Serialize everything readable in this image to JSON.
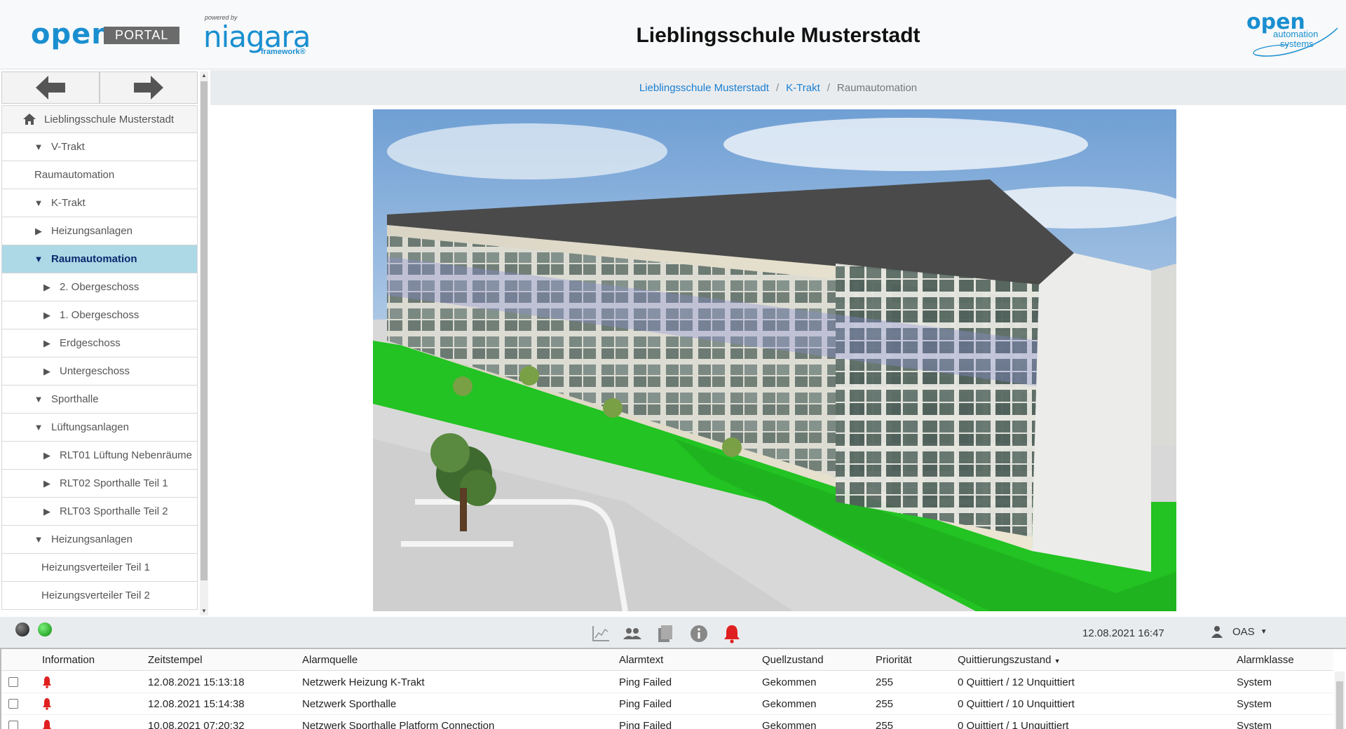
{
  "header": {
    "logo_open": "open",
    "logo_portal": "PORTAL",
    "niagara_powered": "powered by",
    "niagara_name": "niagara",
    "niagara_framework": "framework®",
    "title": "Lieblingsschule Musterstadt",
    "oas_open": "open",
    "oas_line1": "automation",
    "oas_line2": "systems"
  },
  "sidebar": {
    "items": [
      {
        "label": "Lieblingsschule Musterstadt",
        "icon": "home-icon"
      },
      {
        "label": "V-Trakt",
        "icon": "triangle-down-icon"
      },
      {
        "label": "Raumautomation",
        "icon": ""
      },
      {
        "label": "K-Trakt",
        "icon": "triangle-down-icon"
      },
      {
        "label": "Heizungsanlagen",
        "icon": "triangle-right-icon"
      },
      {
        "label": "Raumautomation",
        "icon": "triangle-down-icon"
      },
      {
        "label": "2. Obergeschoss",
        "icon": "triangle-right-icon"
      },
      {
        "label": "1. Obergeschoss",
        "icon": "triangle-right-icon"
      },
      {
        "label": "Erdgeschoss",
        "icon": "triangle-right-icon"
      },
      {
        "label": "Untergeschoss",
        "icon": "triangle-right-icon"
      },
      {
        "label": "Sporthalle",
        "icon": "triangle-down-icon"
      },
      {
        "label": "Lüftungsanlagen",
        "icon": "triangle-down-icon"
      },
      {
        "label": "RLT01 Lüftung Nebenräume",
        "icon": "triangle-right-icon"
      },
      {
        "label": "RLT02 Sporthalle Teil 1",
        "icon": "triangle-right-icon"
      },
      {
        "label": "RLT03 Sporthalle Teil 2",
        "icon": "triangle-right-icon"
      },
      {
        "label": "Heizungsanlagen",
        "icon": "triangle-down-icon"
      },
      {
        "label": "Heizungsverteiler Teil 1",
        "icon": ""
      },
      {
        "label": "Heizungsverteiler Teil 2",
        "icon": ""
      }
    ],
    "selected_index": 5
  },
  "breadcrumb": {
    "items": [
      "Lieblingsschule Musterstadt",
      "K-Trakt"
    ],
    "separator": "/",
    "current": "Raumautomation"
  },
  "statusbar": {
    "datetime": "12.08.2021 16:47",
    "user": "OAS",
    "connection_dots": [
      "#333333",
      "#1fbf1f"
    ],
    "tools": [
      "chart-icon",
      "users-icon",
      "document-icon",
      "info-icon",
      "alarm-bell-icon"
    ]
  },
  "alarms": {
    "columns": {
      "info": "Information",
      "time": "Zeitstempel",
      "source": "Alarmquelle",
      "text": "Alarmtext",
      "state": "Quellzustand",
      "priority": "Priorität",
      "ack": "Quittierungszustand",
      "class": "Alarmklasse"
    },
    "rows": [
      {
        "time": "12.08.2021 15:13:18",
        "source": "Netzwerk Heizung K-Trakt",
        "text": "Ping Failed",
        "state": "Gekommen",
        "priority": "255",
        "ack": "0 Quittiert / 12 Unquittiert",
        "class": "System"
      },
      {
        "time": "12.08.2021 15:14:38",
        "source": "Netzwerk Sporthalle",
        "text": "Ping Failed",
        "state": "Gekommen",
        "priority": "255",
        "ack": "0 Quittiert / 10 Unquittiert",
        "class": "System"
      },
      {
        "time": "10.08.2021 07:20:32",
        "source": "Netzwerk Sporthalle Platform Connection",
        "text": "Ping Failed",
        "state": "Gekommen",
        "priority": "255",
        "ack": "0 Quittiert / 1 Unquittiert",
        "class": "System"
      }
    ]
  },
  "colors": {
    "brand_blue": "#1a8fd0",
    "selected_bg": "#add8e6",
    "alarm_red": "#e02020"
  }
}
